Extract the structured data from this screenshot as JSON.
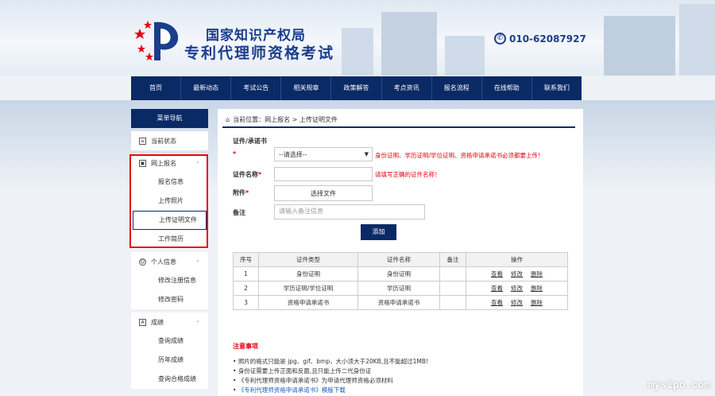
{
  "header": {
    "title_line1": "国家知识产权局",
    "title_line2": "专利代理师资格考试",
    "phone": "010-62087927"
  },
  "nav": [
    "首页",
    "最新动态",
    "考试公告",
    "相关规章",
    "政策解答",
    "考点资讯",
    "报名流程",
    "在线帮助",
    "联系我们"
  ],
  "sidebar": {
    "head": "菜单导航",
    "current_status": "当前状态",
    "groups": [
      {
        "label": "网上报名",
        "items": [
          "报名信息",
          "上传照片",
          "上传证明文件",
          "工作简历"
        ]
      },
      {
        "label": "个人信息",
        "items": [
          "修改注册信息",
          "修改密码"
        ]
      },
      {
        "label": "成绩",
        "items": [
          "查询成绩",
          "历年成绩",
          "查询合格成绩"
        ]
      }
    ]
  },
  "breadcrumb": {
    "prefix": "当前位置：",
    "path": "网上报名 > 上传证明文件"
  },
  "form": {
    "type_label": "证件/承诺书",
    "star": "*",
    "type_select": "--请选择--",
    "type_hint": "身份证明、学历证明/学位证明、资格申请承诺书必须都要上传!",
    "name_label": "证件名称",
    "name_hint": "请填写正确的证件名称！",
    "attach_label": "附件",
    "attach_button": "选择文件",
    "remark_label": "备注",
    "remark_placeholder": "请输入备注信息",
    "add_button": "添加"
  },
  "table": {
    "headers": [
      "序号",
      "证件类型",
      "证件名称",
      "备注",
      "操作"
    ],
    "rows": [
      {
        "no": "1",
        "type": "身份证明",
        "name": "身份证明",
        "remark": ""
      },
      {
        "no": "2",
        "type": "学历证明/学位证明",
        "name": "学历证明",
        "remark": ""
      },
      {
        "no": "3",
        "type": "资格申请承诺书",
        "name": "资格申请承诺书",
        "remark": ""
      }
    ],
    "actions": [
      "查看",
      "修改",
      "删除"
    ]
  },
  "notice": {
    "title": "注意事项",
    "items": [
      "照片的格式只能是 jpg、gif、bmp，大小须大于20KB,且不能超过1MB!",
      "身份证需要上传正面和反面,且只能上传二代身份证",
      "《专利代理师资格申请承诺书》为申请代理师资格必须材料"
    ],
    "link_item": "《专利代理师资格申请承诺书》",
    "link_download": "模版下载"
  },
  "watermark": "mysipo.com",
  "colors": {
    "primary": "#0a2a66",
    "alert": "#e60012",
    "link": "#1b5fbf"
  }
}
